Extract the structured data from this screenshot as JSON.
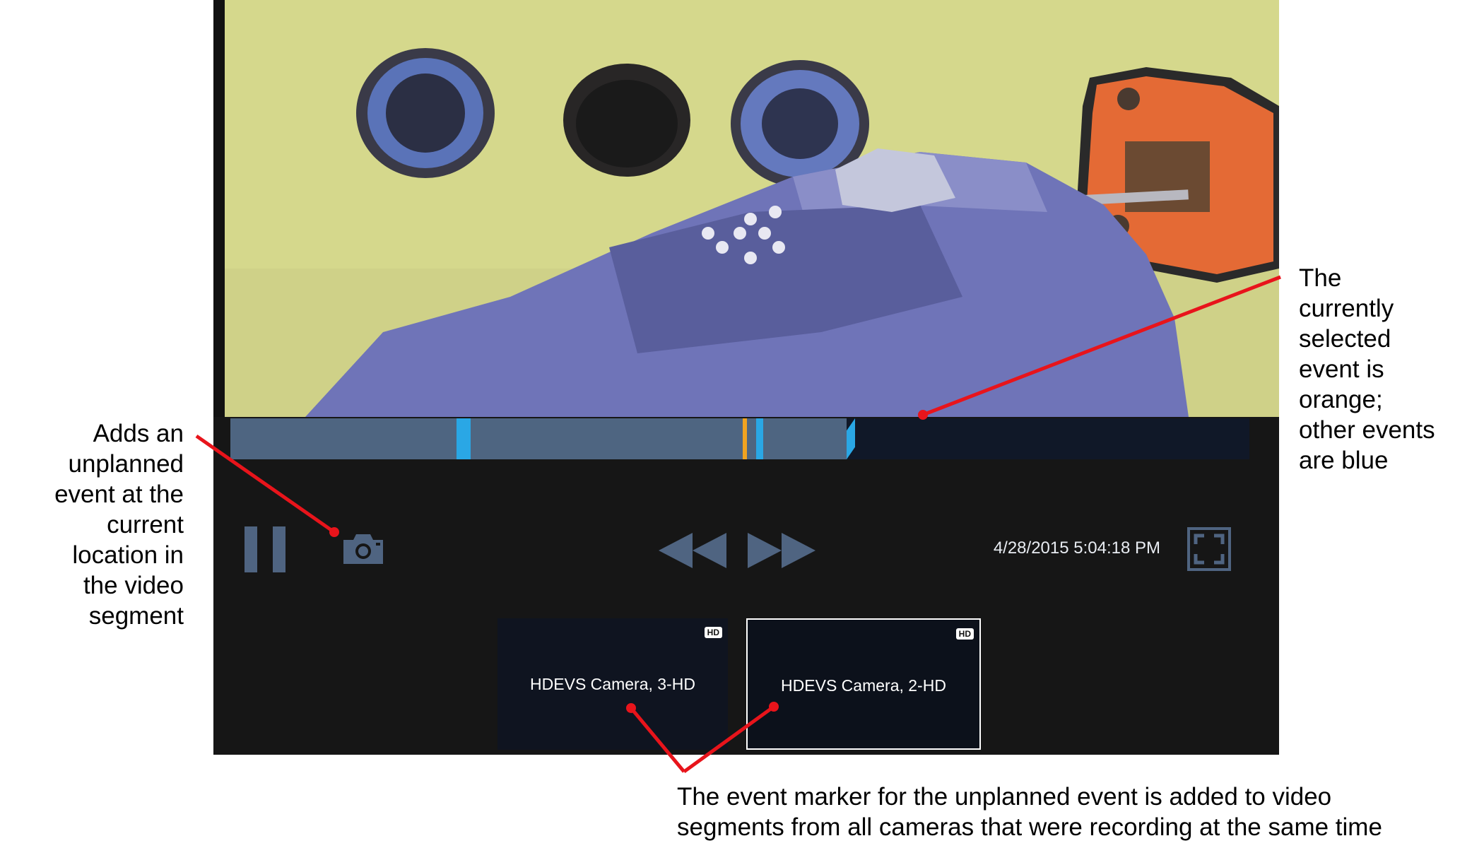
{
  "player": {
    "timestamp": "4/28/2015 5:04:18 PM",
    "timeline": {
      "played_fraction": 0.605,
      "segment_end_fraction": 0.62,
      "events": [
        {
          "position": 0.222,
          "color": "#2aa7e5",
          "selected": false
        },
        {
          "position": 0.229,
          "color": "#2aa7e5",
          "selected": false
        },
        {
          "position": 0.5025,
          "color": "#f0a321",
          "selected": true
        },
        {
          "position": 0.516,
          "color": "#2aa7e5",
          "selected": false
        }
      ]
    },
    "controls": {
      "pause_icon": "pause-icon",
      "camera_icon": "camera-icon",
      "rewind_icon": "rewind-icon",
      "fast_forward_icon": "fast-forward-icon",
      "fullscreen_icon": "fullscreen-icon"
    },
    "cameras": [
      {
        "name": "HDEVS Camera, 3-HD",
        "badge": "HD",
        "selected": false
      },
      {
        "name": "HDEVS Camera, 2-HD",
        "badge": "HD",
        "selected": true
      }
    ]
  },
  "annotations": {
    "left": "Adds an\nunplanned\nevent at the\ncurrent\nlocation in\nthe video\nsegment",
    "right": "The\ncurrently\nselected\nevent is\norange;\nother events\nare blue",
    "bottom": "The event marker for the unplanned event is added to video\nsegments from all cameras that were recording at the same time"
  },
  "colors": {
    "player_bg": "#161616",
    "timeline_played": "#4e6581",
    "event_blue": "#2aa7e5",
    "event_selected": "#f0a321",
    "control_icon": "#4f6481",
    "callout_line": "#e8141b"
  }
}
